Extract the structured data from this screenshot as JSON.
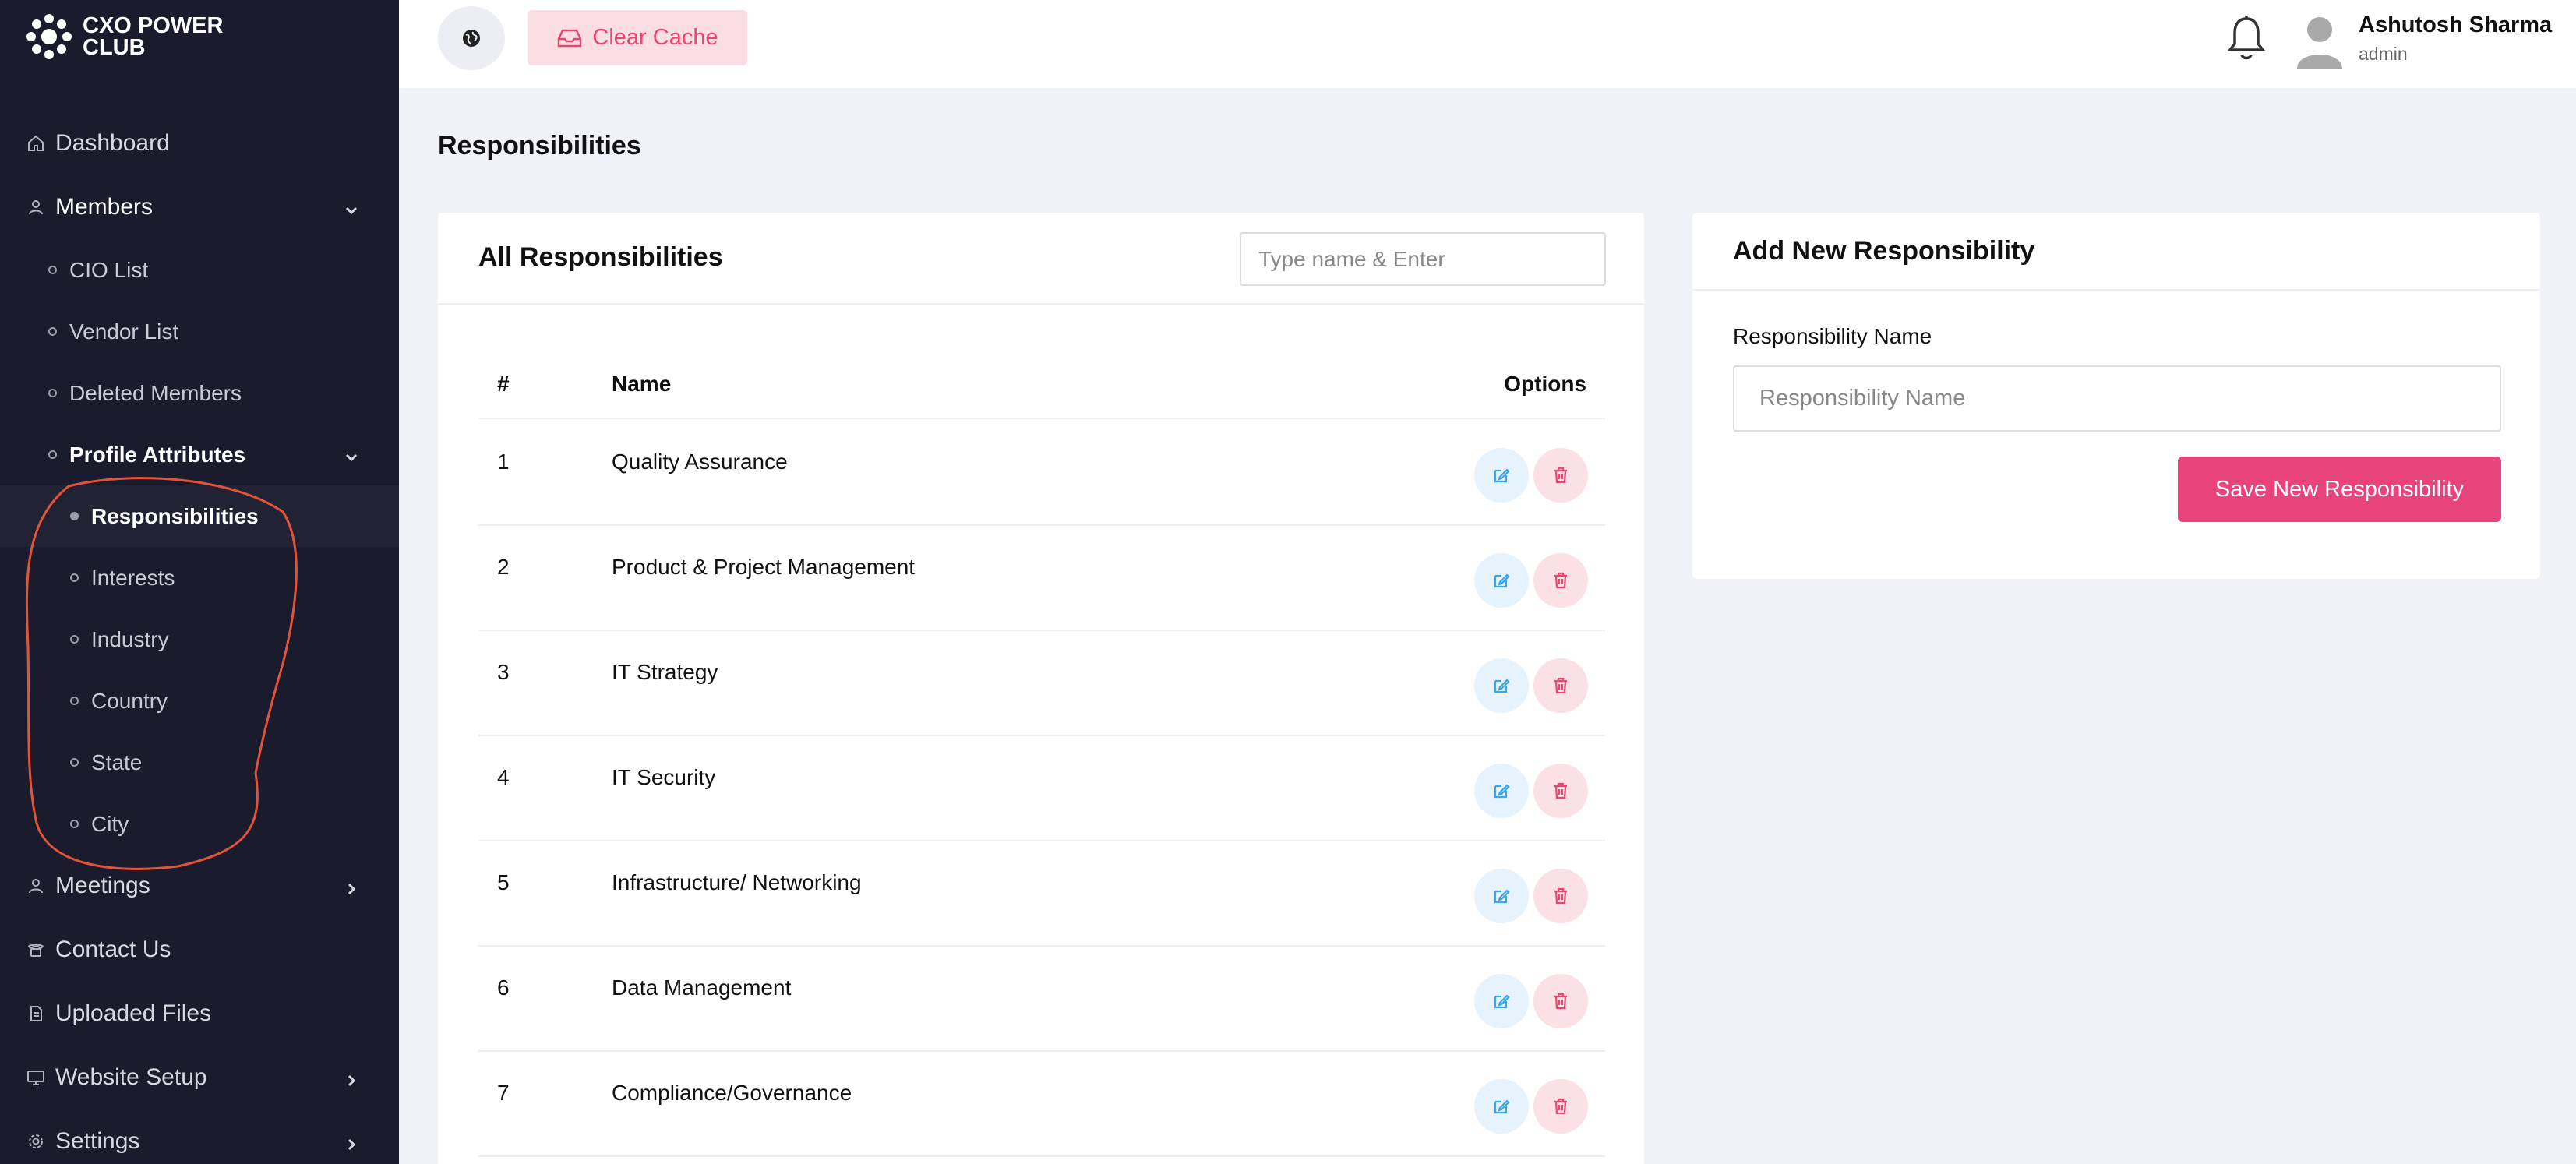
{
  "brand": {
    "line1": "CXO POWER",
    "line2": "CLUB"
  },
  "sidebar": {
    "dashboard": "Dashboard",
    "members": "Members",
    "members_sub": [
      "CIO List",
      "Vendor List",
      "Deleted Members"
    ],
    "profile_attributes": "Profile Attributes",
    "profile_sub": [
      "Responsibilities",
      "Interests",
      "Industry",
      "Country",
      "State",
      "City"
    ],
    "meetings": "Meetings",
    "contact_us": "Contact Us",
    "uploaded_files": "Uploaded Files",
    "website_setup": "Website Setup",
    "settings": "Settings"
  },
  "topbar": {
    "clear_cache": "Clear Cache",
    "user_name": "Ashutosh Sharma",
    "user_role": "admin"
  },
  "page_title": "Responsibilities",
  "list_card": {
    "title": "All Responsibilities",
    "search_placeholder": "Type name & Enter",
    "columns": {
      "num": "#",
      "name": "Name",
      "options": "Options"
    },
    "rows": [
      {
        "num": "1",
        "name": "Quality Assurance"
      },
      {
        "num": "2",
        "name": "Product & Project Management"
      },
      {
        "num": "3",
        "name": "IT Strategy"
      },
      {
        "num": "4",
        "name": "IT Security"
      },
      {
        "num": "5",
        "name": "Infrastructure/ Networking"
      },
      {
        "num": "6",
        "name": "Data Management"
      },
      {
        "num": "7",
        "name": "Compliance/Governance"
      }
    ]
  },
  "add_card": {
    "title": "Add New Responsibility",
    "field_label": "Responsibility Name",
    "field_placeholder": "Responsibility Name",
    "save_label": "Save New Responsibility"
  },
  "colors": {
    "sidebar_bg": "#1b1b2e",
    "accent_pink": "#e8437a",
    "edit_blue": "#3aa6e8",
    "annotation_red": "#e2543a"
  },
  "icons": {
    "home": "home-icon",
    "user": "user-icon",
    "chevron": "chevron-icon",
    "phone": "phone-icon",
    "file": "file-icon",
    "monitor": "monitor-icon",
    "gear": "gear-icon",
    "globe": "globe-icon",
    "inbox": "inbox-icon",
    "bell": "bell-icon",
    "edit": "edit-icon",
    "trash": "trash-icon"
  }
}
